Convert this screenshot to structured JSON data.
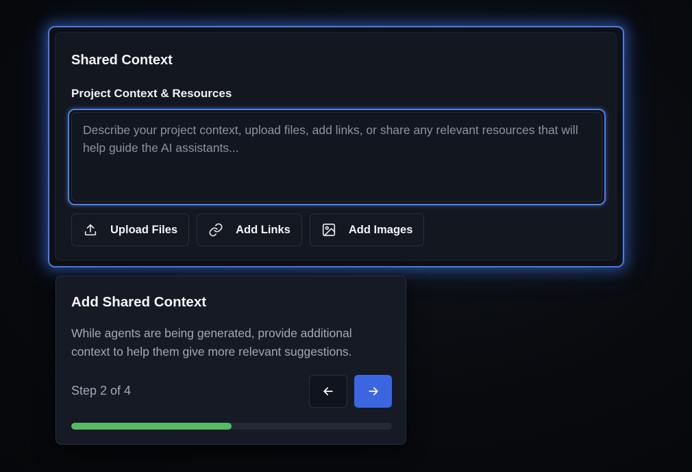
{
  "shared_context": {
    "title": "Shared Context",
    "field_label": "Project Context & Resources",
    "textarea_value": "",
    "textarea_placeholder": "Describe your project context, upload files, add links, or share any relevant resources that will help guide the AI assistants...",
    "buttons": [
      {
        "label": "Upload Files",
        "icon": "upload-icon"
      },
      {
        "label": "Add Links",
        "icon": "link-icon"
      },
      {
        "label": "Add Images",
        "icon": "image-icon"
      }
    ]
  },
  "tour": {
    "title": "Add Shared Context",
    "body": "While agents are being generated, provide additional context to help them give more relevant suggestions.",
    "step_text": "Step 2 of 4",
    "progress_fraction": 0.5,
    "prev_icon": "arrow-left-icon",
    "next_icon": "arrow-right-icon"
  },
  "colors": {
    "accent": "#4a7fe0",
    "next_button": "#3c66e0",
    "progress": "#55bb62"
  }
}
